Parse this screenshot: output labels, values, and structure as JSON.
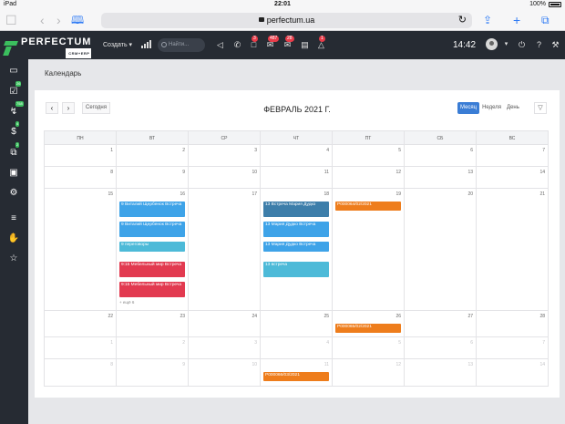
{
  "ios": {
    "device": "iPad",
    "time": "22:01",
    "battery": "100%"
  },
  "browser": {
    "url": "perfectum.ua"
  },
  "topbar": {
    "brand": "PERFECTUM",
    "brand_sub": "CRM+ERP",
    "create_label": "Создать",
    "search_placeholder": "Найти...",
    "badges": [
      "3",
      "487",
      "28",
      "1"
    ],
    "clock": "14:42"
  },
  "sidebar": {
    "badges": [
      "26",
      "758",
      "4",
      "2"
    ]
  },
  "page": {
    "title": "Календарь"
  },
  "calendar": {
    "today_label": "Сегодня",
    "title": "ФЕВРАЛЬ 2021 Г.",
    "views": [
      "Месяц",
      "Неделя",
      "День"
    ],
    "weekdays": [
      "ПН",
      "ВТ",
      "СР",
      "ЧТ",
      "ПТ",
      "СБ",
      "ВС"
    ],
    "weeks": [
      {
        "days": [
          "1",
          "2",
          "3",
          "4",
          "5",
          "6",
          "7"
        ],
        "other": []
      },
      {
        "days": [
          "8",
          "9",
          "10",
          "11",
          "12",
          "13",
          "14"
        ],
        "other": []
      },
      {
        "days": [
          "15",
          "16",
          "17",
          "18",
          "19",
          "20",
          "21"
        ],
        "other": []
      },
      {
        "days": [
          "22",
          "23",
          "24",
          "25",
          "26",
          "27",
          "28"
        ],
        "other": []
      },
      {
        "days": [
          "1",
          "2",
          "3",
          "4",
          "5",
          "6",
          "7"
        ],
        "other": [
          0,
          1,
          2,
          3,
          4,
          5,
          6
        ]
      },
      {
        "days": [
          "8",
          "9",
          "10",
          "11",
          "12",
          "13",
          "14"
        ],
        "other": [
          0,
          1,
          2,
          3,
          4,
          5,
          6
        ]
      }
    ],
    "events": [
      {
        "week": 2,
        "day": 1,
        "slot": 0,
        "text": "9 Виталий Щербенок Встреча",
        "color": "#3ea3e8"
      },
      {
        "week": 2,
        "day": 1,
        "slot": 1,
        "text": "9 Виталий Щербенок Встреча",
        "color": "#3ea3e8"
      },
      {
        "week": 2,
        "day": 1,
        "slot": 2,
        "text": "9 переговоры",
        "color": "#4dbad8"
      },
      {
        "week": 2,
        "day": 1,
        "slot": 3,
        "text": "9:15 Мебельный мир Встреча",
        "color": "#e23a50"
      },
      {
        "week": 2,
        "day": 1,
        "slot": 4,
        "text": "9:15 Мебельный мир Встреча",
        "color": "#e23a50"
      },
      {
        "week": 2,
        "day": 3,
        "slot": 0,
        "text": "13 Встреча Мария Дудко",
        "color": "#3d7eaa"
      },
      {
        "week": 2,
        "day": 3,
        "slot": 1,
        "text": "13 Мария Дудко Встреча",
        "color": "#3ea3e8"
      },
      {
        "week": 2,
        "day": 3,
        "slot": 2,
        "text": "13 Мария Дудко Встреча",
        "color": "#3ea3e8"
      },
      {
        "week": 2,
        "day": 3,
        "slot": 3,
        "text": "13 встреча",
        "color": "#4dbad8"
      },
      {
        "week": 2,
        "day": 4,
        "slot": 0,
        "text": "Р000064/02/2021",
        "color": "#ee7d1c"
      },
      {
        "week": 3,
        "day": 4,
        "slot": 0,
        "text": "Р000065/02/2021",
        "color": "#ee7d1c"
      },
      {
        "week": 5,
        "day": 3,
        "slot": 0,
        "text": "Р000066/03/2021",
        "color": "#ee7d1c"
      }
    ],
    "more_label": "+ ещё 6"
  }
}
